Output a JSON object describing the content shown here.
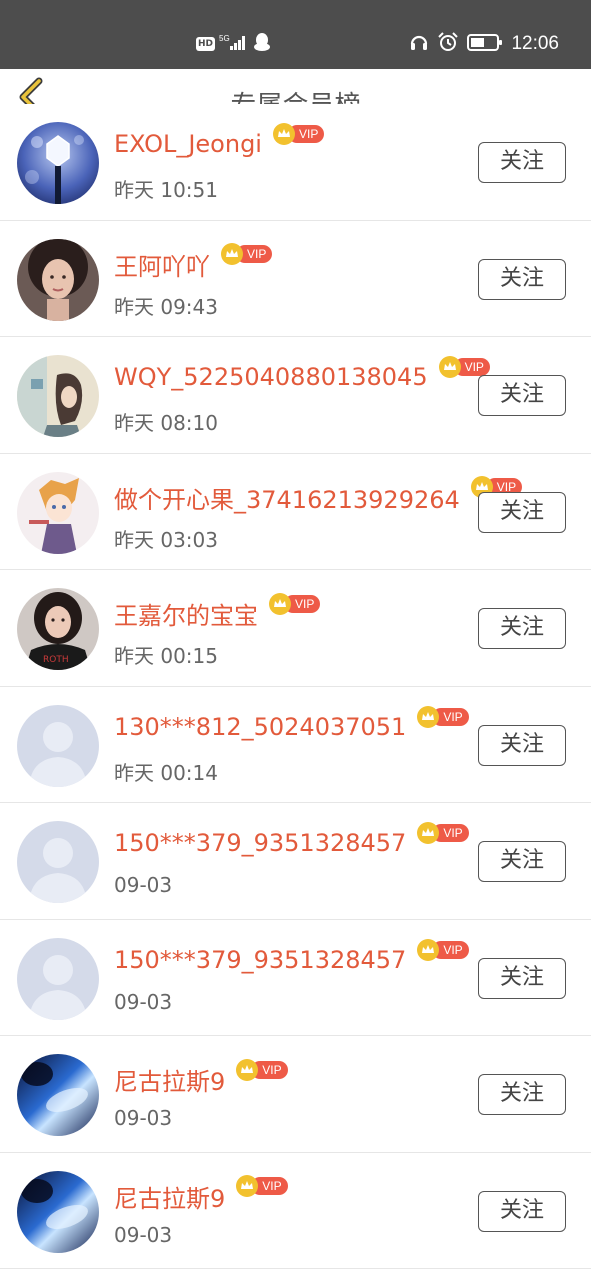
{
  "status_bar": {
    "hd": "HD",
    "network": "5G",
    "time": "12:06"
  },
  "header": {
    "title": "专属会员榜"
  },
  "vip_badge_text": "VIP",
  "follow_label": "关注",
  "members": [
    {
      "name": "EXOL_Jeongi",
      "time": "昨天 10:51",
      "avatar": "lightstick-photo"
    },
    {
      "name": "王阿吖吖",
      "time": "昨天 09:43",
      "avatar": "portrait-photo"
    },
    {
      "name": "WQY_5225040880138045",
      "time": "昨天 08:10",
      "avatar": "illustration-photo"
    },
    {
      "name": "做个开心果_37416213929264",
      "time": "昨天 03:03",
      "avatar": "anime-photo"
    },
    {
      "name": "王嘉尔的宝宝",
      "time": "昨天 00:15",
      "avatar": "portrait-photo"
    },
    {
      "name": "130***812_5024037051",
      "time": "昨天 00:14",
      "avatar": "default-person"
    },
    {
      "name": "150***379_9351328457",
      "time": "09-03",
      "avatar": "default-person"
    },
    {
      "name": "150***379_9351328457",
      "time": "09-03",
      "avatar": "default-person"
    },
    {
      "name": "尼古拉斯9",
      "time": "09-03",
      "avatar": "blue-abstract-photo"
    },
    {
      "name": "尼古拉斯9",
      "time": "09-03",
      "avatar": "blue-abstract-photo"
    }
  ],
  "colors": {
    "status_bar_bg": "#4d4d4d",
    "name": "#e25a3b",
    "vip_pill": "#ee5a47",
    "crown": "#f2c12e",
    "back_arrow": "#e9c33b"
  }
}
